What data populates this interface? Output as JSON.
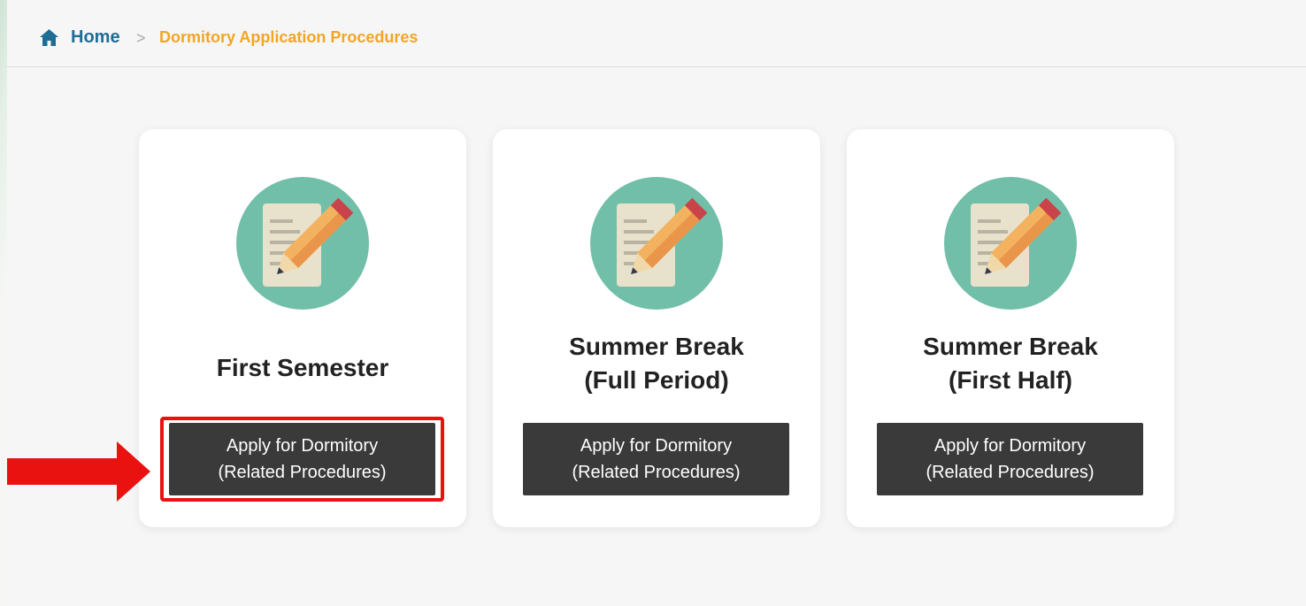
{
  "breadcrumb": {
    "home_label": "Home",
    "separator": ">",
    "current_label": "Dormitory Application Procedures",
    "home_icon": "home-icon"
  },
  "cards": [
    {
      "title_lines": [
        "First Semester"
      ],
      "icon": "document-pencil-icon",
      "button_lines": [
        "Apply for Dormitory",
        "(Related Procedures)"
      ]
    },
    {
      "title_lines": [
        "Summer Break",
        "(Full Period)"
      ],
      "icon": "document-pencil-icon",
      "button_lines": [
        "Apply for Dormitory",
        "(Related Procedures)"
      ]
    },
    {
      "title_lines": [
        "Summer Break",
        "(First Half)"
      ],
      "icon": "document-pencil-icon",
      "button_lines": [
        "Apply for Dormitory",
        "(Related Procedures)"
      ]
    }
  ],
  "annotation": {
    "arrow_icon": "red-arrow-right-icon",
    "highlight_color": "#ea1111"
  },
  "colors": {
    "link": "#1f6d96",
    "current": "#f3a524",
    "button": "#3a3a3a",
    "icon_circle": "#72bfa9"
  }
}
